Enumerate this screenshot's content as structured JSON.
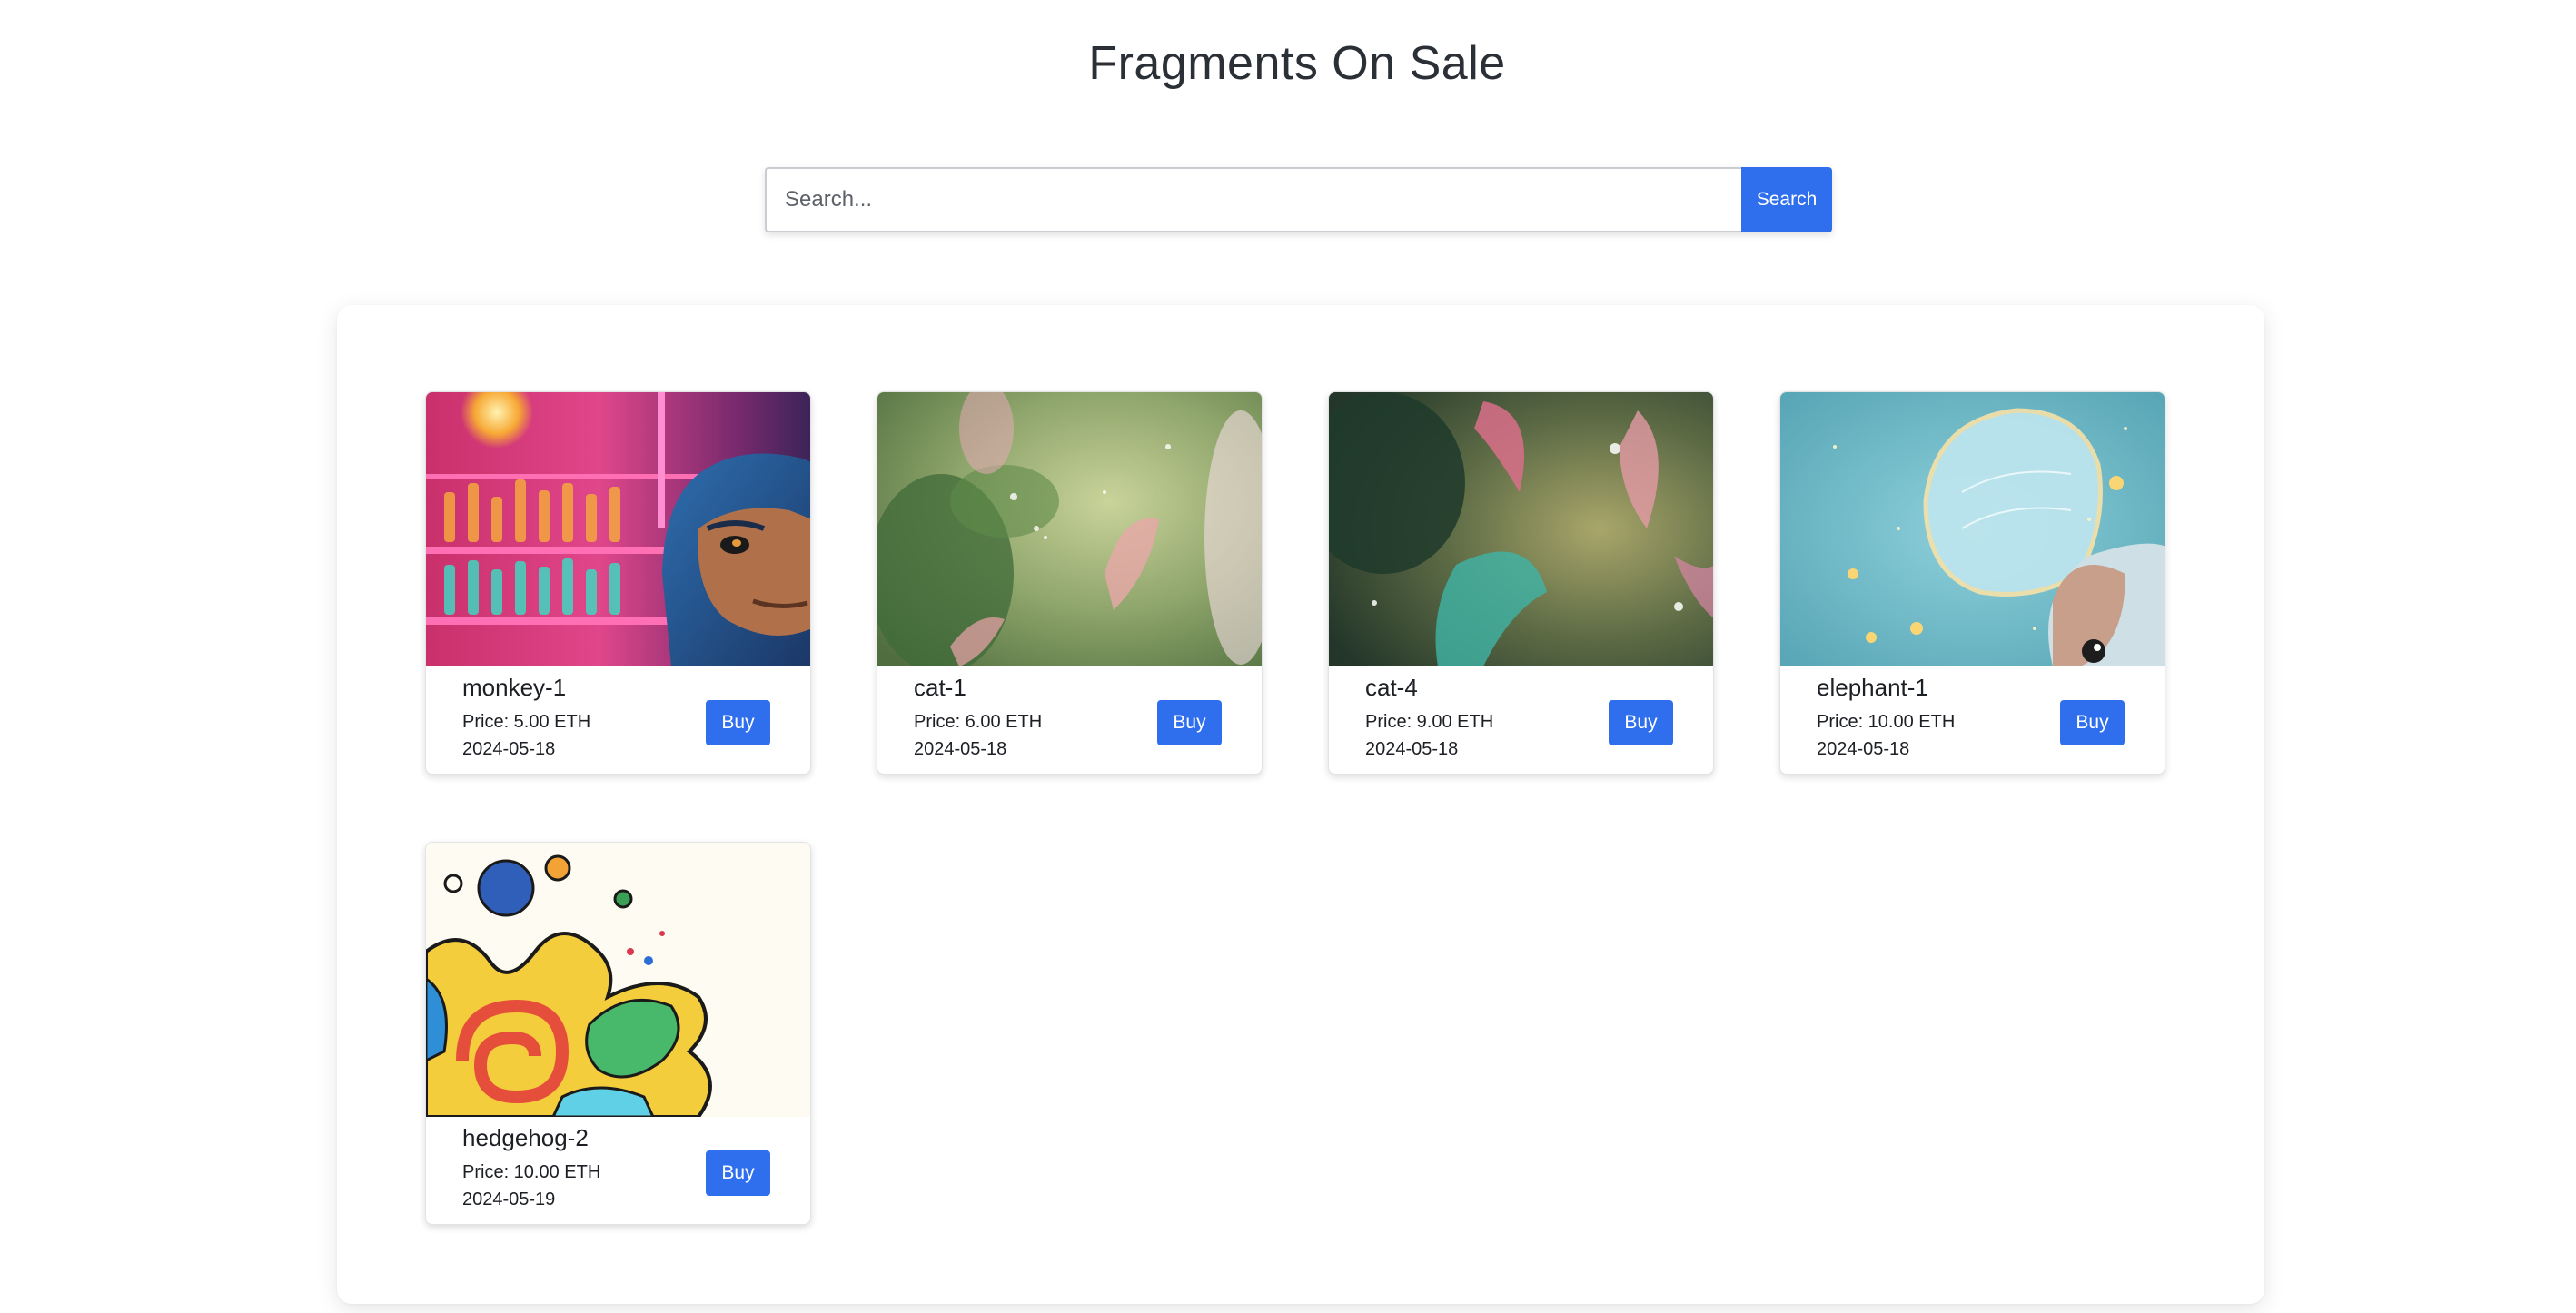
{
  "page": {
    "title": "Fragments On Sale"
  },
  "search": {
    "placeholder": "Search...",
    "value": "",
    "button_label": "Search"
  },
  "fragments": [
    {
      "name": "monkey-1",
      "price": "Price: 5.00 ETH",
      "date": "2024-05-18",
      "buy_label": "Buy",
      "image": "neon-bar-monkey"
    },
    {
      "name": "cat-1",
      "price": "Price: 6.00 ETH",
      "date": "2024-05-18",
      "buy_label": "Buy",
      "image": "green-foliage-bokeh"
    },
    {
      "name": "cat-4",
      "price": "Price: 9.00 ETH",
      "date": "2024-05-18",
      "buy_label": "Buy",
      "image": "dark-jungle-leaves"
    },
    {
      "name": "elephant-1",
      "price": "Price: 10.00 ETH",
      "date": "2024-05-18",
      "buy_label": "Buy",
      "image": "winged-elephant-sky"
    },
    {
      "name": "hedgehog-2",
      "price": "Price: 10.00 ETH",
      "date": "2024-05-19",
      "buy_label": "Buy",
      "image": "colorful-paint-swirls"
    }
  ],
  "colors": {
    "accent": "#2f6fed",
    "panel_background": "#ffffff"
  }
}
